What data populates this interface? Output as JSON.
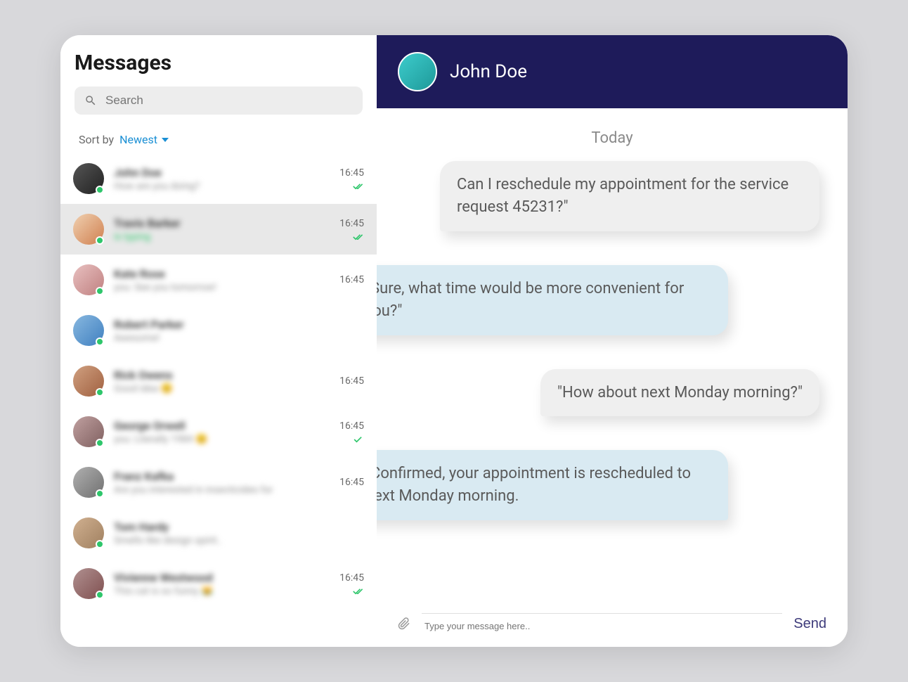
{
  "sidebar": {
    "title": "Messages",
    "search_placeholder": "Search",
    "sort_label": "Sort by",
    "sort_value": "Newest",
    "conversations": [
      {
        "name": "John Doe",
        "preview": "How are you doing?",
        "time": "16:45",
        "status": "double",
        "typing": false
      },
      {
        "name": "Travis Barker",
        "preview": "is typing",
        "time": "16:45",
        "status": "double",
        "typing": true
      },
      {
        "name": "Kate Rose",
        "preview": "you: See you tomorrow!",
        "time": "16:45",
        "status": "",
        "typing": false
      },
      {
        "name": "Robert Parker",
        "preview": "Awesome!",
        "time": "",
        "status": "",
        "typing": false
      },
      {
        "name": "Rick Owens",
        "preview": "Good idea 😊",
        "time": "16:45",
        "status": "",
        "typing": false
      },
      {
        "name": "George Orwell",
        "preview": "you: Literally 1984 😊",
        "time": "16:45",
        "status": "single",
        "typing": false
      },
      {
        "name": "Franz Kafka",
        "preview": "Are you interested in insecticides for",
        "time": "16:45",
        "status": "",
        "typing": false
      },
      {
        "name": "Tom Hardy",
        "preview": "Smells like design spirit..",
        "time": "",
        "status": "",
        "typing": false
      },
      {
        "name": "Vivienne Westwood",
        "preview": "This cat is so funny 😹",
        "time": "16:45",
        "status": "double",
        "typing": false
      }
    ]
  },
  "chat": {
    "contact_name": "John Doe",
    "date_label": "Today",
    "messages": [
      {
        "side": "in",
        "text": "Can I reschedule my appointment for the service request 45231?\""
      },
      {
        "side": "out",
        "text": "\"Sure, what time would be more convenient for you?\""
      },
      {
        "side": "in",
        "text": "\"How about next Monday morning?\""
      },
      {
        "side": "out",
        "text": "\"Confirmed, your appointment is rescheduled to next Monday morning."
      }
    ],
    "input_placeholder": "Type your message here..",
    "send_label": "Send"
  }
}
